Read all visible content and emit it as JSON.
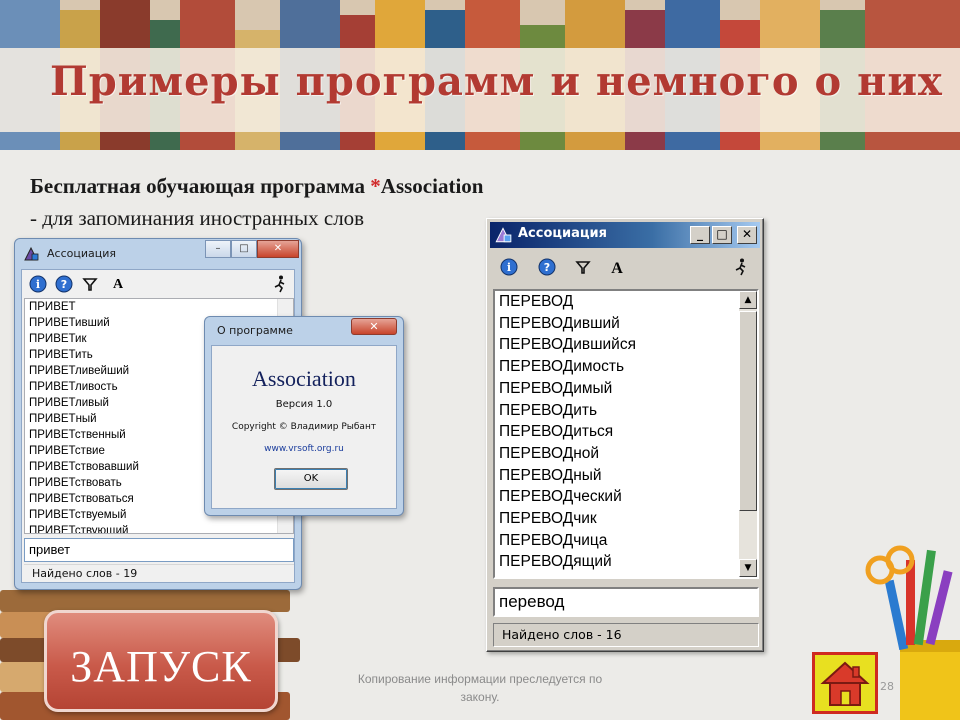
{
  "slide": {
    "title": "Примеры программ и немного о них",
    "heading_line1_prefix": "Бесплатная обучающая программа ",
    "heading_star": "*",
    "heading_line1_suffix": "Association",
    "heading_line2": "- для запоминания иностранных слов",
    "launch_label": "ЗАПУСК",
    "footer_text": "Копирование информации преследуется по закону.",
    "page_number": "28",
    "accent_color": "#b23a32"
  },
  "left_window": {
    "title": "Ассоциация",
    "toolbar_icons": [
      "info-icon",
      "help-icon",
      "filter-icon",
      "font-icon",
      "runner-icon"
    ],
    "font_glyph": "A",
    "list_items": [
      "ПРИВЕТ",
      "ПРИВЕТивший",
      "ПРИВЕТик",
      "ПРИВЕТить",
      "ПРИВЕТливейший",
      "ПРИВЕТливость",
      "ПРИВЕТливый",
      "ПРИВЕТный",
      "ПРИВЕТственный",
      "ПРИВЕТствие",
      "ПРИВЕТствовавший",
      "ПРИВЕТствовать",
      "ПРИВЕТствоваться",
      "ПРИВЕТствуемый",
      "ПРИВЕТствующий"
    ],
    "input_value": "привет",
    "status": "Найдено слов - 19"
  },
  "about_dialog": {
    "title": "О программе",
    "app_name": "Association",
    "version": "Версия 1.0",
    "copyright": "Copyright © Владимир Рыбант",
    "website": "www.vrsoft.org.ru",
    "ok_label": "OK"
  },
  "right_window": {
    "title": "Ассоциация",
    "controls": [
      "_",
      "□",
      "✕"
    ],
    "font_glyph": "A",
    "list_items": [
      "ПЕРЕВОД",
      "ПЕРЕВОДивший",
      "ПЕРЕВОДившийся",
      "ПЕРЕВОДимость",
      "ПЕРЕВОДимый",
      "ПЕРЕВОДить",
      "ПЕРЕВОДиться",
      "ПЕРЕВОДной",
      "ПЕРЕВОДный",
      "ПЕРЕВОДческий",
      "ПЕРЕВОДчик",
      "ПЕРЕВОДчица",
      "ПЕРЕВОДящий"
    ],
    "input_value": "перевод",
    "status": "Найдено слов - 16"
  }
}
